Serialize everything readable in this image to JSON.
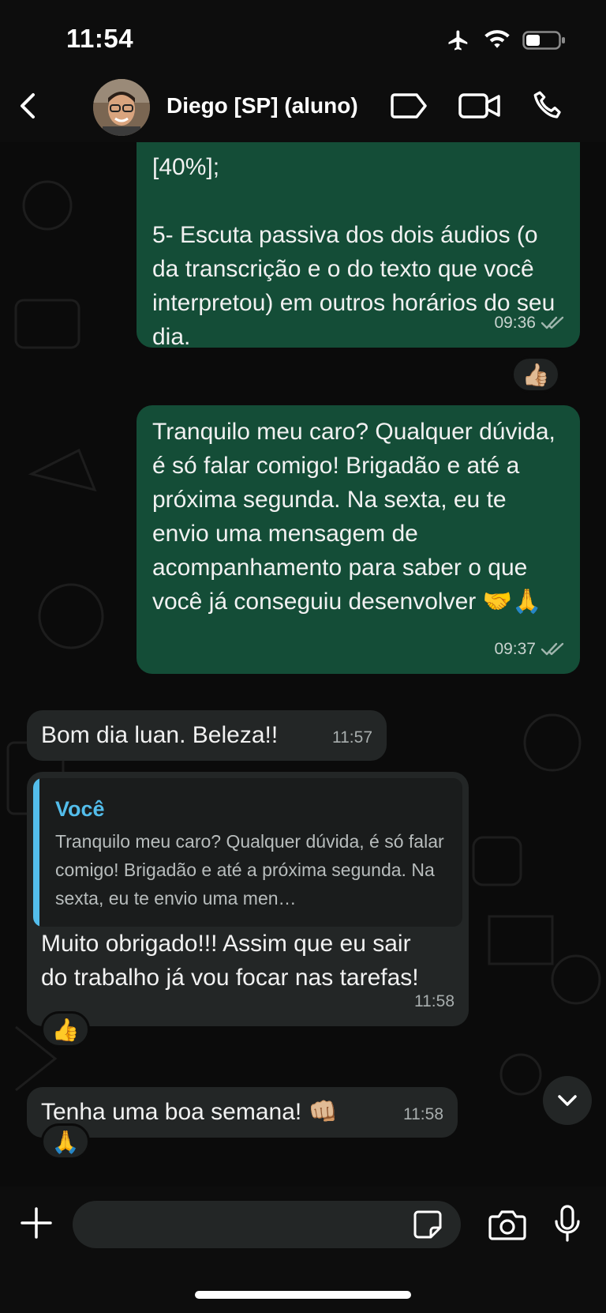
{
  "status": {
    "time": "11:54"
  },
  "header": {
    "contact_name": "Diego [SP] (aluno)"
  },
  "messages": [
    {
      "direction": "out",
      "text": "[40%];\n\n5- Escuta passiva dos dois áudios (o da transcrição e o do texto que você interpretou) em outros horários do seu dia.",
      "time": "09:36",
      "reaction": "👍🏼"
    },
    {
      "direction": "out",
      "text": "Tranquilo meu caro? Qualquer dúvida, é só falar comigo! Brigadão e até a próxima segunda. Na sexta, eu te envio uma mensagem de acompanhamento para saber o que você já conseguiu desenvolver 🤝🙏",
      "time": "09:37"
    },
    {
      "direction": "in",
      "text": "Bom dia luan. Beleza!!",
      "time": "11:57"
    },
    {
      "direction": "in",
      "quote_author": "Você",
      "quote_text": "Tranquilo meu caro? Qualquer dúvida, é só falar comigo! Brigadão e até a próxima segunda. Na sexta, eu te envio uma men…",
      "text": "Muito obrigado!!! Assim que eu sair do trabalho já vou focar nas tarefas!",
      "time": "11:58",
      "reaction": "👍"
    },
    {
      "direction": "in",
      "text": "Tenha uma boa semana! 👊🏼",
      "time": "11:58",
      "reaction": "🙏"
    }
  ],
  "icons": {
    "back": "chevron-left-icon",
    "label": "label-tag-icon",
    "video": "video-camera-icon",
    "phone": "phone-icon",
    "read": "double-check-icon",
    "scroll": "chevron-down-icon",
    "plus": "plus-icon",
    "sticker": "sticker-icon",
    "camera": "camera-icon",
    "mic": "microphone-icon"
  },
  "colors": {
    "outgoing_bubble": "#144d37",
    "incoming_bubble": "#232626",
    "quote_accent": "#53bdeb",
    "background": "#0b0b0b"
  }
}
